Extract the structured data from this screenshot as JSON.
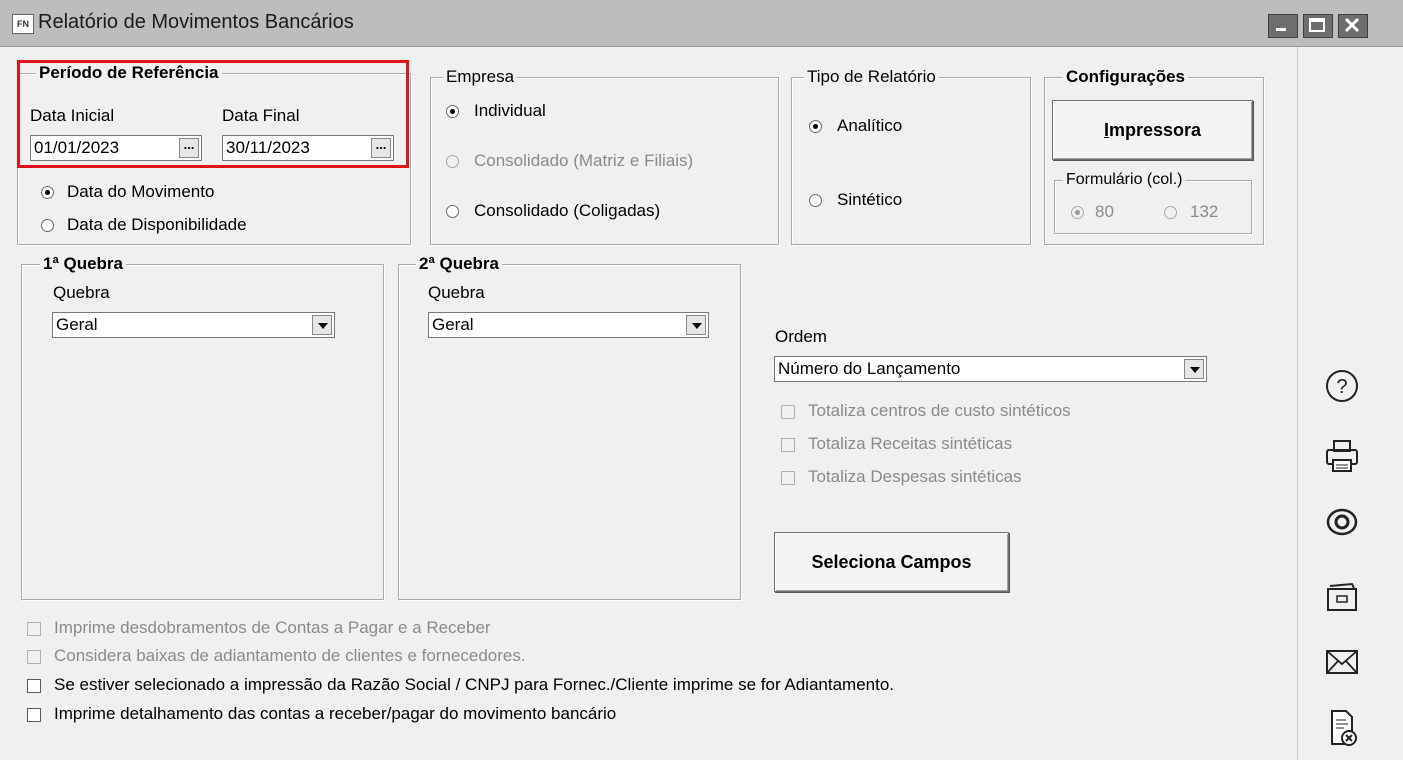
{
  "window": {
    "app_icon_text": "FN",
    "title": "Relatório de Movimentos Bancários"
  },
  "periodo": {
    "legend": "Período de Referência",
    "data_inicial_label": "Data Inicial",
    "data_inicial_value": "01/01/2023",
    "data_final_label": "Data Final",
    "data_final_value": "30/11/2023",
    "dots": "...",
    "opt_movimento": "Data do Movimento",
    "opt_disponibilidade": "Data de Disponibilidade"
  },
  "empresa": {
    "legend": "Empresa",
    "opt_individual": "Individual",
    "opt_consolidado_matriz": "Consolidado (Matriz e Filiais)",
    "opt_consolidado_coligadas": "Consolidado (Coligadas)"
  },
  "tipo": {
    "legend": "Tipo de Relatório",
    "opt_analitico": "Analítico",
    "opt_sintetico": "Sintético"
  },
  "config": {
    "legend": "Configurações",
    "impressora_prefix": "I",
    "impressora_rest": "mpressora",
    "formulario_legend": "Formulário (col.)",
    "opt_80": "80",
    "opt_132": "132"
  },
  "quebra1": {
    "legend": "1ª Quebra",
    "label": "Quebra",
    "value": "Geral"
  },
  "quebra2": {
    "legend": "2ª Quebra",
    "label": "Quebra",
    "value": "Geral"
  },
  "ordem": {
    "label": "Ordem",
    "value": "Número do Lançamento",
    "cb_centros": "Totaliza centros de custo sintéticos",
    "cb_receitas": "Totaliza Receitas sintéticas",
    "cb_despesas": "Totaliza Despesas sintéticas",
    "seleciona_button": "Seleciona Campos"
  },
  "options": {
    "cb_desdobramentos": "Imprime desdobramentos de Contas a Pagar e a Receber",
    "cb_baixas": "Considera baixas de adiantamento de clientes e fornecedores.",
    "cb_razao_social": "Se estiver selecionado a impressão da Razão Social / CNPJ para Fornec./Cliente imprime se for Adiantamento.",
    "cb_detalhamento": "Imprime detalhamento das contas a receber/pagar do movimento bancário"
  },
  "sidebar_icons": [
    "help-icon",
    "printer-icon",
    "preview-eye-icon",
    "file-cabinet-icon",
    "email-icon",
    "report-close-icon"
  ],
  "colors": {
    "highlight": "#e0141a",
    "titlebar": "#bdbdbd"
  }
}
